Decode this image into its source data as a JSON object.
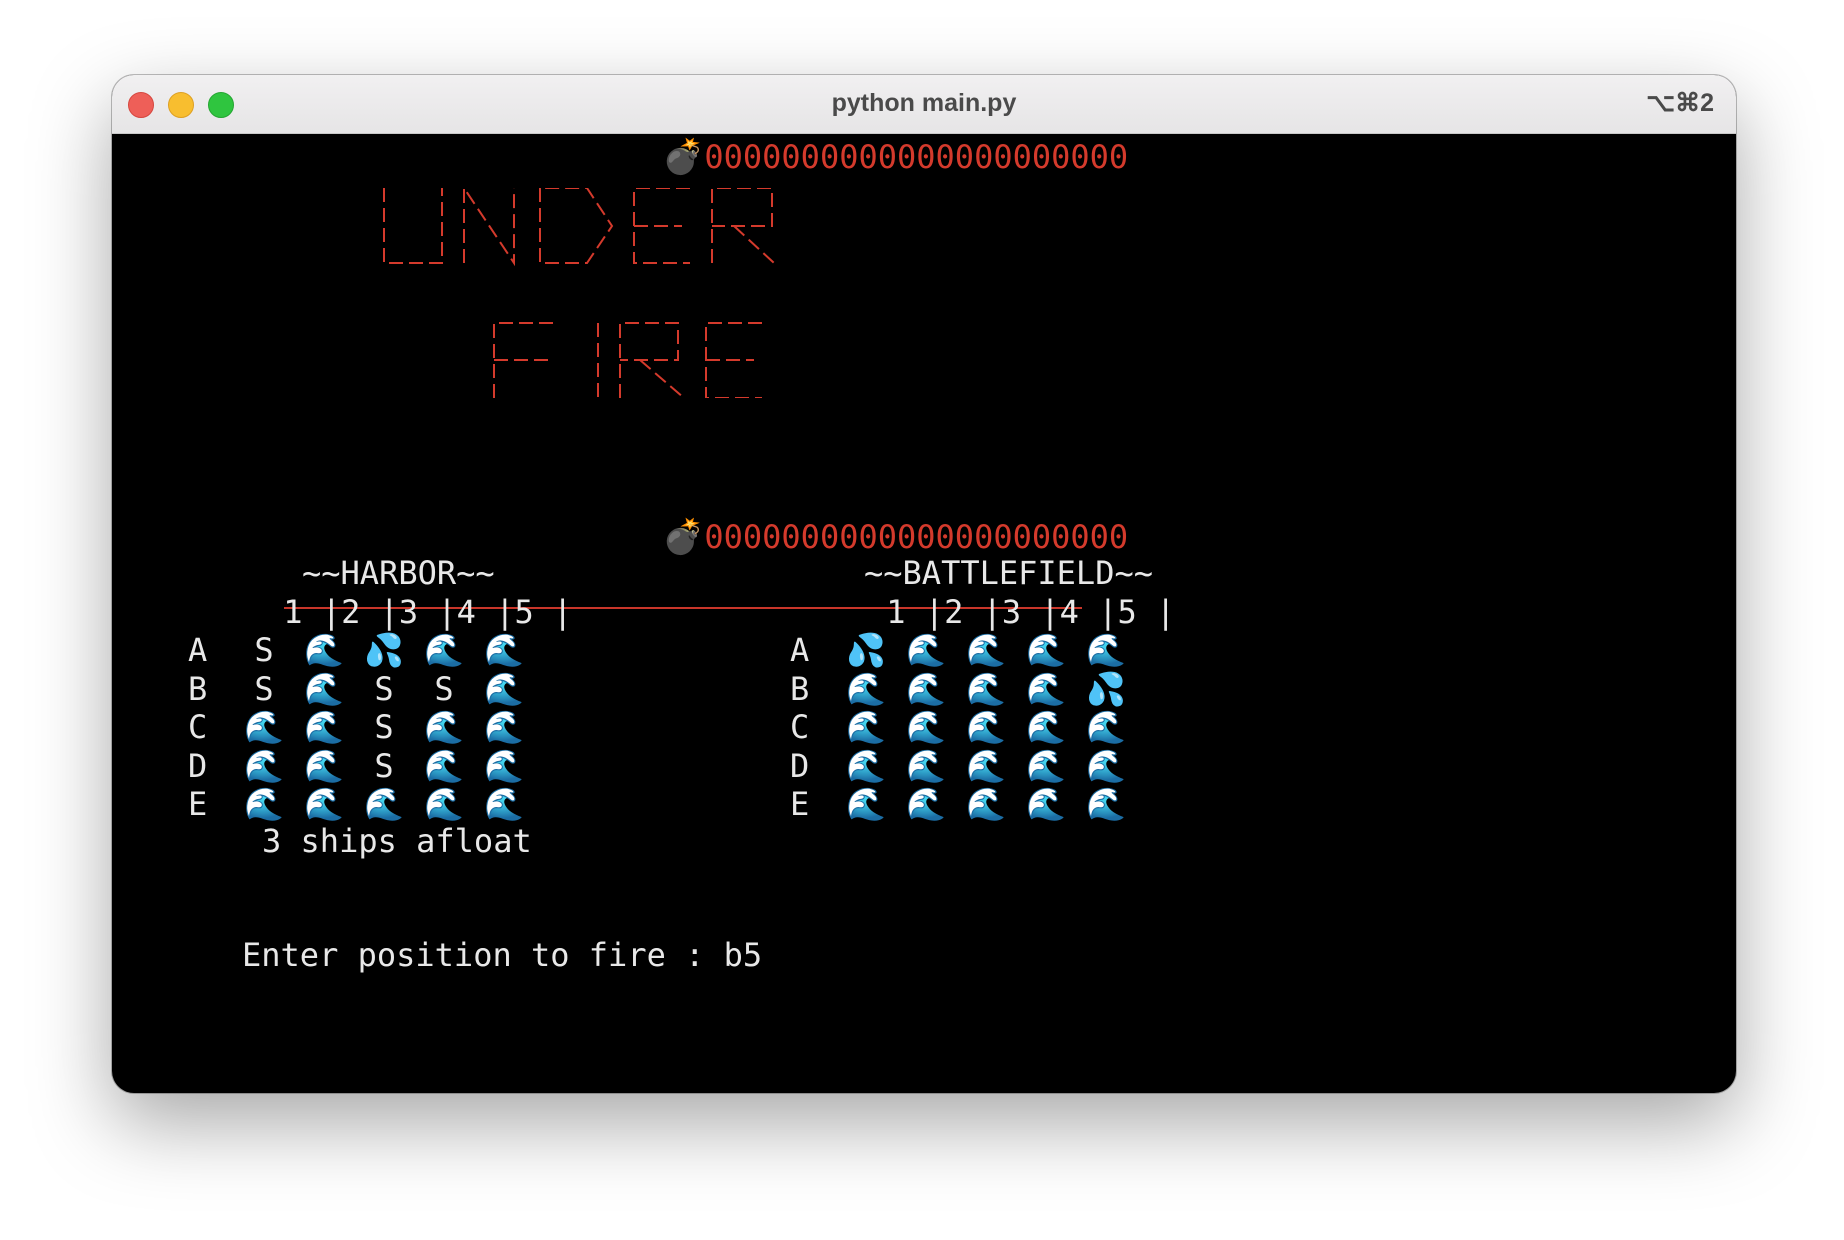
{
  "window": {
    "title": "python main.py",
    "shortcut": "⌥⌘2"
  },
  "banner": {
    "ship_glyph": "🛳",
    "bomb_glyph": "💣",
    "fuse": "0000000000000000000000",
    "title_lines": [
      "UNDER",
      "FIRE"
    ],
    "title_color": "#d43a2c"
  },
  "harbor": {
    "title": "~~HARBOR~~",
    "header": " 1 |2 |3 |4 |5 |",
    "row_labels": [
      "A",
      "B",
      "C",
      "D",
      "E"
    ],
    "grid": [
      [
        "S",
        "🌊",
        "💦",
        "🌊",
        "🌊"
      ],
      [
        "S",
        "🌊",
        "S",
        "S",
        "🌊"
      ],
      [
        "🌊",
        "🌊",
        "S",
        "🌊",
        "🌊"
      ],
      [
        "🌊",
        "🌊",
        "S",
        "🌊",
        "🌊"
      ],
      [
        "🌊",
        "🌊",
        "🌊",
        "🌊",
        "🌊"
      ]
    ],
    "status": "3 ships afloat"
  },
  "battlefield": {
    "title": "~~BATTLEFIELD~~",
    "header": " 1 |2 |3 |4 |5 |",
    "row_labels": [
      "A",
      "B",
      "C",
      "D",
      "E"
    ],
    "grid": [
      [
        "💦",
        "🌊",
        "🌊",
        "🌊",
        "🌊"
      ],
      [
        "🌊",
        "🌊",
        "🌊",
        "🌊",
        "💦"
      ],
      [
        "🌊",
        "🌊",
        "🌊",
        "🌊",
        "🌊"
      ],
      [
        "🌊",
        "🌊",
        "🌊",
        "🌊",
        "🌊"
      ],
      [
        "🌊",
        "🌊",
        "🌊",
        "🌊",
        "🌊"
      ]
    ]
  },
  "prompt": {
    "label": "Enter position to fire : ",
    "value": "b5"
  }
}
